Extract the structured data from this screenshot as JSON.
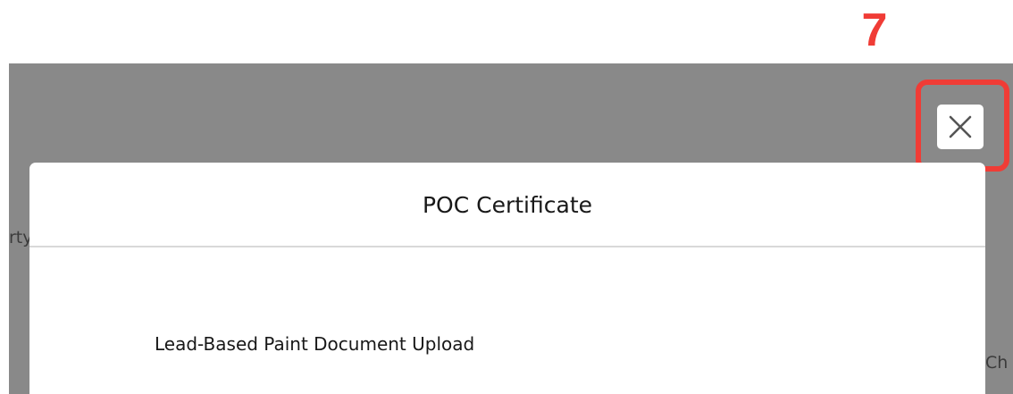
{
  "annotation": {
    "step_number": "7",
    "color": "#f03c36"
  },
  "background": {
    "left_fragment": "rty",
    "right_fragment": "Ch"
  },
  "modal": {
    "title": "POC Certificate",
    "close_icon": "close-icon",
    "body": {
      "section_label": "Lead-Based Paint Document Upload"
    }
  },
  "colors": {
    "overlay": "#898989",
    "modal_background": "#ffffff",
    "divider": "#d9d9d9",
    "text": "#181818"
  }
}
